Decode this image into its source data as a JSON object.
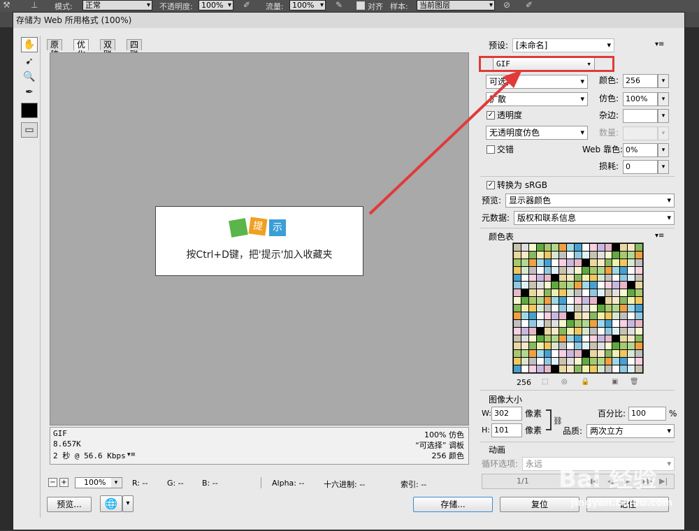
{
  "options_bar": {
    "mode_label": "模式:",
    "mode_value": "正常",
    "opacity_label": "不透明度:",
    "opacity_value": "100%",
    "flow_label": "流量:",
    "flow_value": "100%",
    "align_label": "对齐",
    "sample_label": "样本:",
    "sample_value": "当前图层"
  },
  "dialog": {
    "title": "存储为 Web 所用格式 (100%)",
    "tabs": [
      "原稿",
      "优化",
      "双联",
      "四联"
    ],
    "active_tab": "优化",
    "image_caption": "按Ctrl+D键，把'提示'加入收藏夹",
    "badge_labels": [
      "提",
      "示"
    ],
    "info": {
      "format": "GIF",
      "size": "8.657K",
      "time": "2 秒 @ 56.6 Kbps",
      "dither": "100% 仿色",
      "palette": "“可选择” 调板",
      "colors": "256 颜色"
    },
    "status": {
      "zoom": "100%",
      "r": "R: --",
      "g": "G: --",
      "b": "B: --",
      "alpha": "Alpha: --",
      "hex": "十六进制: --",
      "index": "索引: --"
    },
    "buttons": {
      "preview": "预览...",
      "save": "存储...",
      "reset": "复位",
      "remember": "记住"
    }
  },
  "settings": {
    "preset_label": "预设:",
    "preset_value": "[未命名]",
    "format_value": "GIF",
    "reduction_value": "可选择",
    "dither_algo_value": "扩散",
    "transparency_label": "透明度",
    "transparency_dither_value": "无透明度仿色",
    "interlace_label": "交错",
    "colors_label": "颜色:",
    "colors_value": "256",
    "dither_label": "仿色:",
    "dither_value": "100%",
    "matte_label": "杂边:",
    "amount_label": "数量:",
    "web_snap_label": "Web 靠色:",
    "web_snap_value": "0%",
    "lossy_label": "损耗:",
    "lossy_value": "0",
    "convert_srgb_label": "转换为 sRGB",
    "preview_label": "预览:",
    "preview_value": "显示器颜色",
    "metadata_label": "元数据:",
    "metadata_value": "版权和联系信息",
    "color_table_label": "颜色表",
    "color_count": "256",
    "image_size_label": "图像大小",
    "width_label": "W:",
    "width_value": "302",
    "height_label": "H:",
    "height_value": "101",
    "pixel_unit": "像素",
    "percent_label": "百分比:",
    "percent_value": "100",
    "percent_unit": "%",
    "quality_label": "品质:",
    "quality_value": "两次立方",
    "animation_label": "动画",
    "loop_label": "循环选项:",
    "loop_value": "永远",
    "frame_counter": "1/1"
  },
  "watermark": {
    "brand": "Bai 经验",
    "url": "jingyan.baidu.com"
  },
  "colors": {
    "highlight": "#e03a3a",
    "green_badge": "#5ab54a",
    "orange_badge": "#f0a020",
    "blue_badge": "#3a9ed8"
  }
}
